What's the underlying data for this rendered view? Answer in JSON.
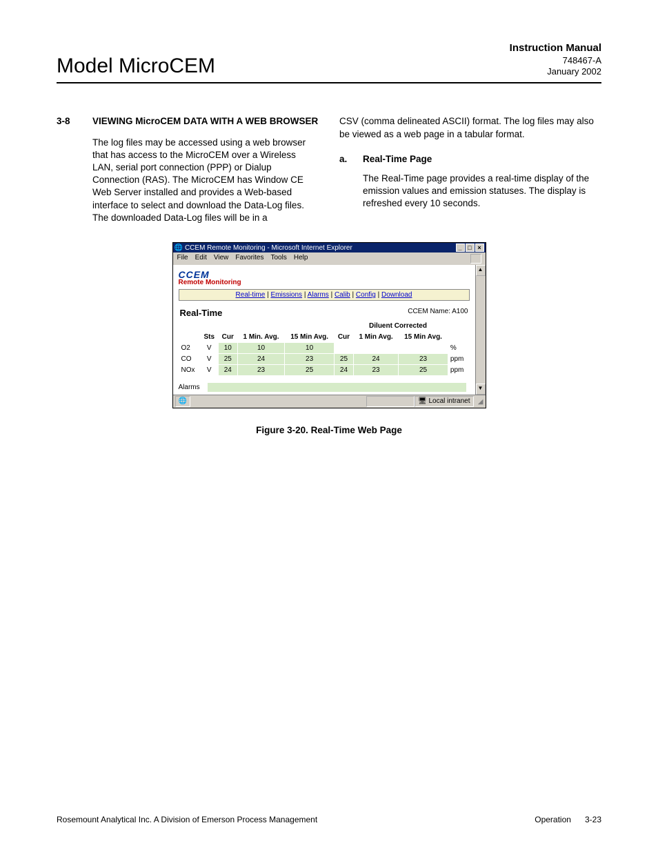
{
  "header": {
    "model": "Model MicroCEM",
    "manual": "Instruction Manual",
    "docnum": "748467-A",
    "date": "January 2002"
  },
  "section": {
    "num": "3-8",
    "title": "VIEWING MicroCEM DATA WITH A WEB BROWSER",
    "left_para": "The log files may be accessed using a web browser that has access to the MicroCEM over a Wireless LAN, serial port connection (PPP) or Dialup Connection (RAS).  The MicroCEM has Window CE Web Server installed and provides a Web-based interface to select and download the Data-Log files. The downloaded Data-Log files will be in a",
    "right_para": "CSV (comma delineated ASCII) format.  The log files may also be viewed as a web page in a tabular format.",
    "sub_letter": "a.",
    "sub_title": "Real-Time Page",
    "sub_para": "The Real-Time page provides a real-time display of the emission values and emission statuses.  The display is refreshed every 10 seconds."
  },
  "browser": {
    "title": "CCEM Remote Monitoring - Microsoft Internet Explorer",
    "menus": [
      "File",
      "Edit",
      "View",
      "Favorites",
      "Tools",
      "Help"
    ],
    "logo": "CCEM",
    "subtitle": "Remote Monitoring",
    "nav": [
      "Real-time",
      "Emissions",
      "Alarms",
      "Calib",
      "Config",
      "Download"
    ],
    "rt_title": "Real-Time",
    "ccem_name": "CCEM Name: A100",
    "diluent": "Diluent Corrected",
    "headers": [
      "",
      "Sts",
      "Cur",
      "1 Min. Avg.",
      "15 Min Avg.",
      "Cur",
      "1 Min Avg.",
      "15 Min Avg.",
      ""
    ],
    "rows": [
      {
        "label": "O2",
        "sts": "V",
        "cur": "10",
        "m1": "10",
        "m15": "10",
        "dc": "",
        "d1": "",
        "d15": "",
        "unit": "%"
      },
      {
        "label": "CO",
        "sts": "V",
        "cur": "25",
        "m1": "24",
        "m15": "23",
        "dc": "25",
        "d1": "24",
        "d15": "23",
        "unit": "ppm"
      },
      {
        "label": "NOx",
        "sts": "V",
        "cur": "24",
        "m1": "23",
        "m15": "25",
        "dc": "24",
        "d1": "23",
        "d15": "25",
        "unit": "ppm"
      }
    ],
    "alarms_label": "Alarms",
    "status_zone": "Local intranet"
  },
  "figure_caption": "Figure 3-20.  Real-Time Web Page",
  "footer": {
    "left": "Rosemount Analytical Inc.    A Division of Emerson Process Management",
    "right_section": "Operation",
    "right_page": "3-23"
  }
}
